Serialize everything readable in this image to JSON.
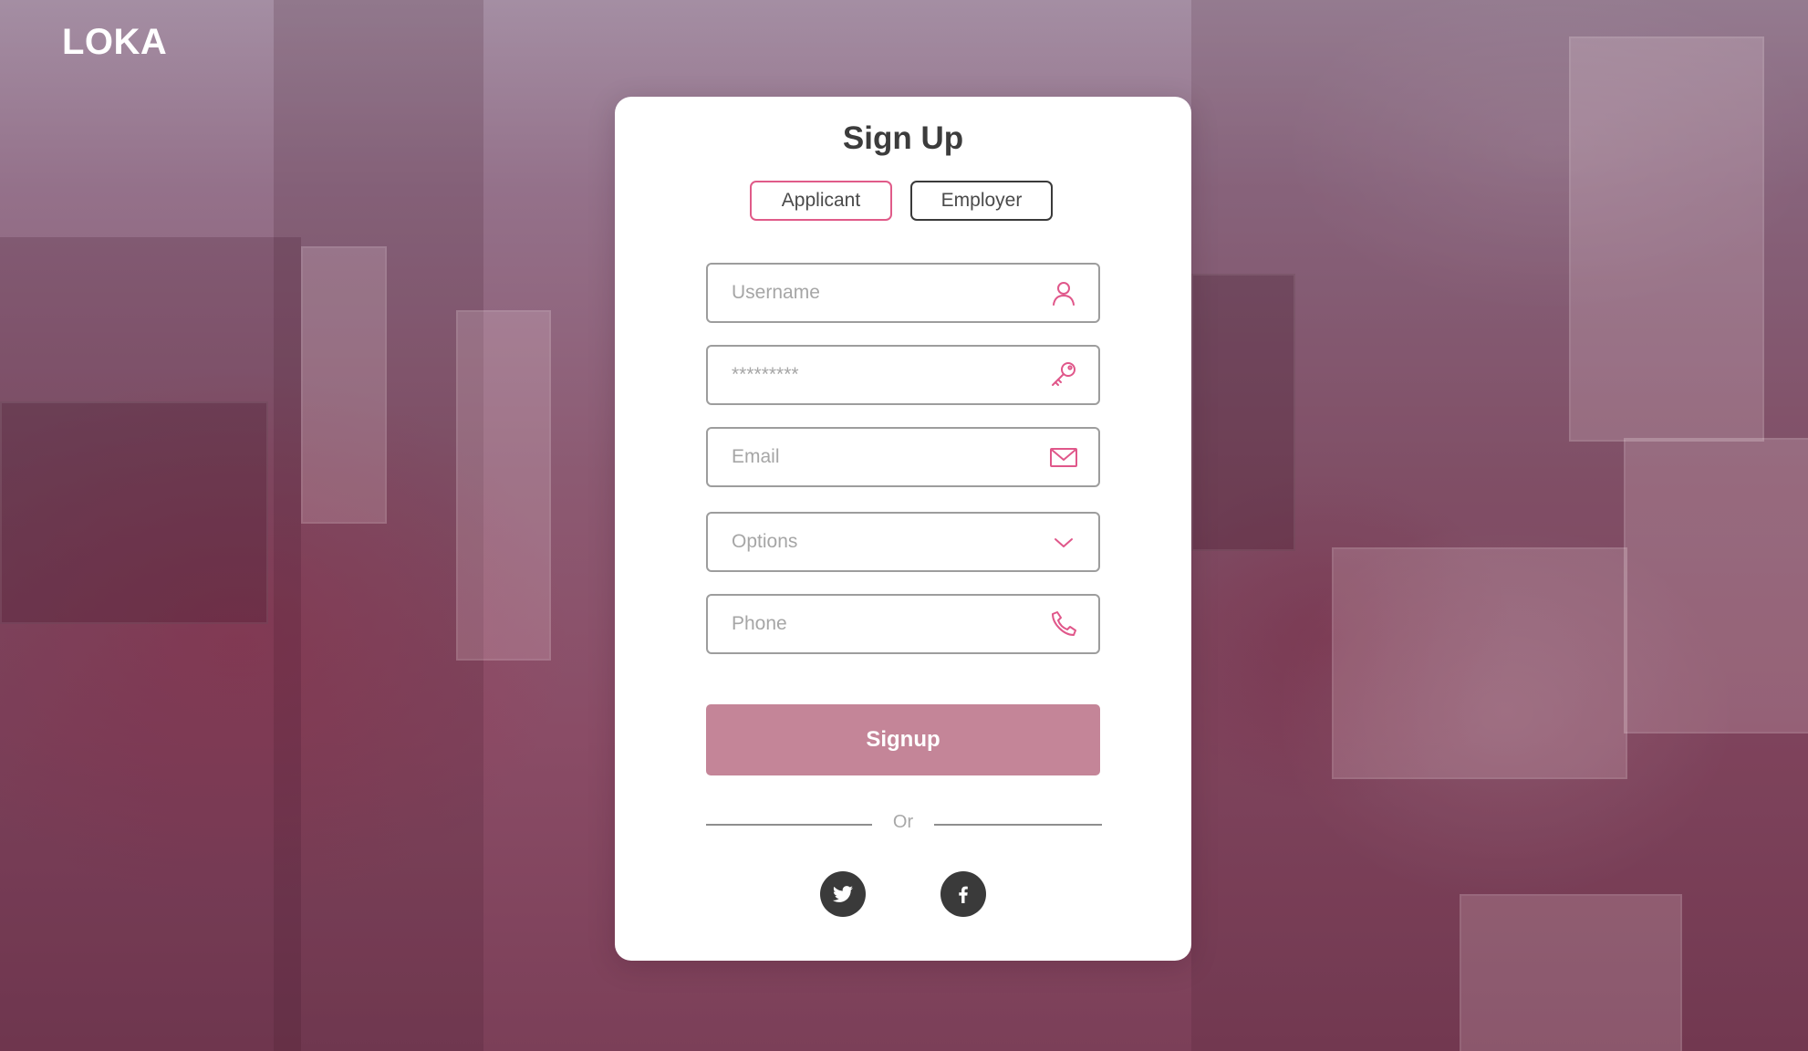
{
  "app": {
    "brand": "LOKA"
  },
  "form": {
    "title": "Sign Up",
    "roles": [
      {
        "label": "Applicant",
        "selected": true
      },
      {
        "label": "Employer",
        "selected": false
      }
    ],
    "fields": {
      "username": {
        "placeholder": "Username",
        "icon": "user-icon"
      },
      "password": {
        "placeholder": "*********",
        "icon": "key-icon"
      },
      "email": {
        "placeholder": "Email",
        "icon": "mail-icon"
      },
      "options": {
        "value": "Options",
        "icon": "chevron-down-icon"
      },
      "phone": {
        "placeholder": "Phone",
        "icon": "phone-icon"
      }
    },
    "submit_label": "Signup",
    "divider_text": "Or",
    "social": [
      {
        "name": "twitter",
        "icon": "twitter-icon"
      },
      {
        "name": "facebook",
        "icon": "facebook-icon"
      }
    ]
  },
  "colors": {
    "accent_pink": "#e05b89",
    "submit_button": "#c48598",
    "icon_pink": "#e0578a",
    "social_bg": "#3a3a3a"
  }
}
